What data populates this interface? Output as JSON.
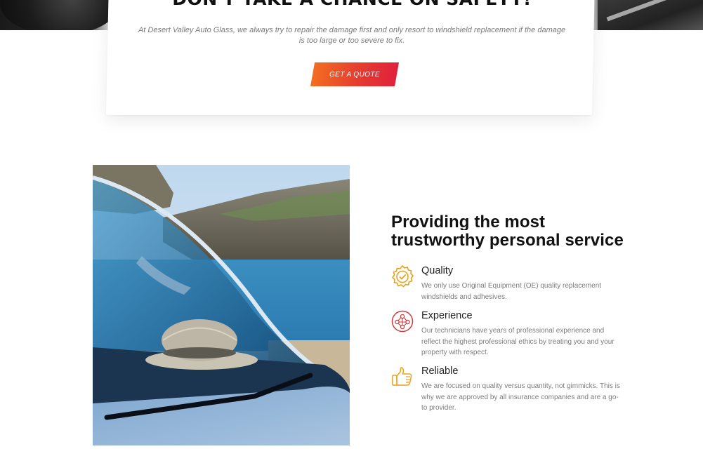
{
  "cta": {
    "title": "DON'T TAKE A CHANCE ON SAFETY!",
    "text": "At Desert Valley Auto Glass, we always try to repair the damage first and only resort to windshield replacement if the damage is too large or too severe to fix.",
    "button_label": "GET A QUOTE"
  },
  "about": {
    "heading_line1": "Providing the most",
    "heading_line2": "trustworthy personal service",
    "features": [
      {
        "title": "Quality",
        "description": "We only use Original Equipment (OE) quality replacement windshields and adhesives.",
        "icon": "badge-check-icon"
      },
      {
        "title": "Experience",
        "description": "Our technicians have years of professional experience and reflect the highest professional ethics by treating you and your property with respect.",
        "icon": "team-network-icon"
      },
      {
        "title": "Reliable",
        "description": "We are focused on quality versus quantity, not gimmicks. This is why we are approved by all insurance companies and are a go-to provider.",
        "icon": "thumbs-up-icon"
      }
    ]
  },
  "colors": {
    "accent_orange": "#f26d22",
    "accent_red": "#e0213b",
    "icon_gold": "#e8a21a",
    "icon_red": "#d13a3a"
  }
}
